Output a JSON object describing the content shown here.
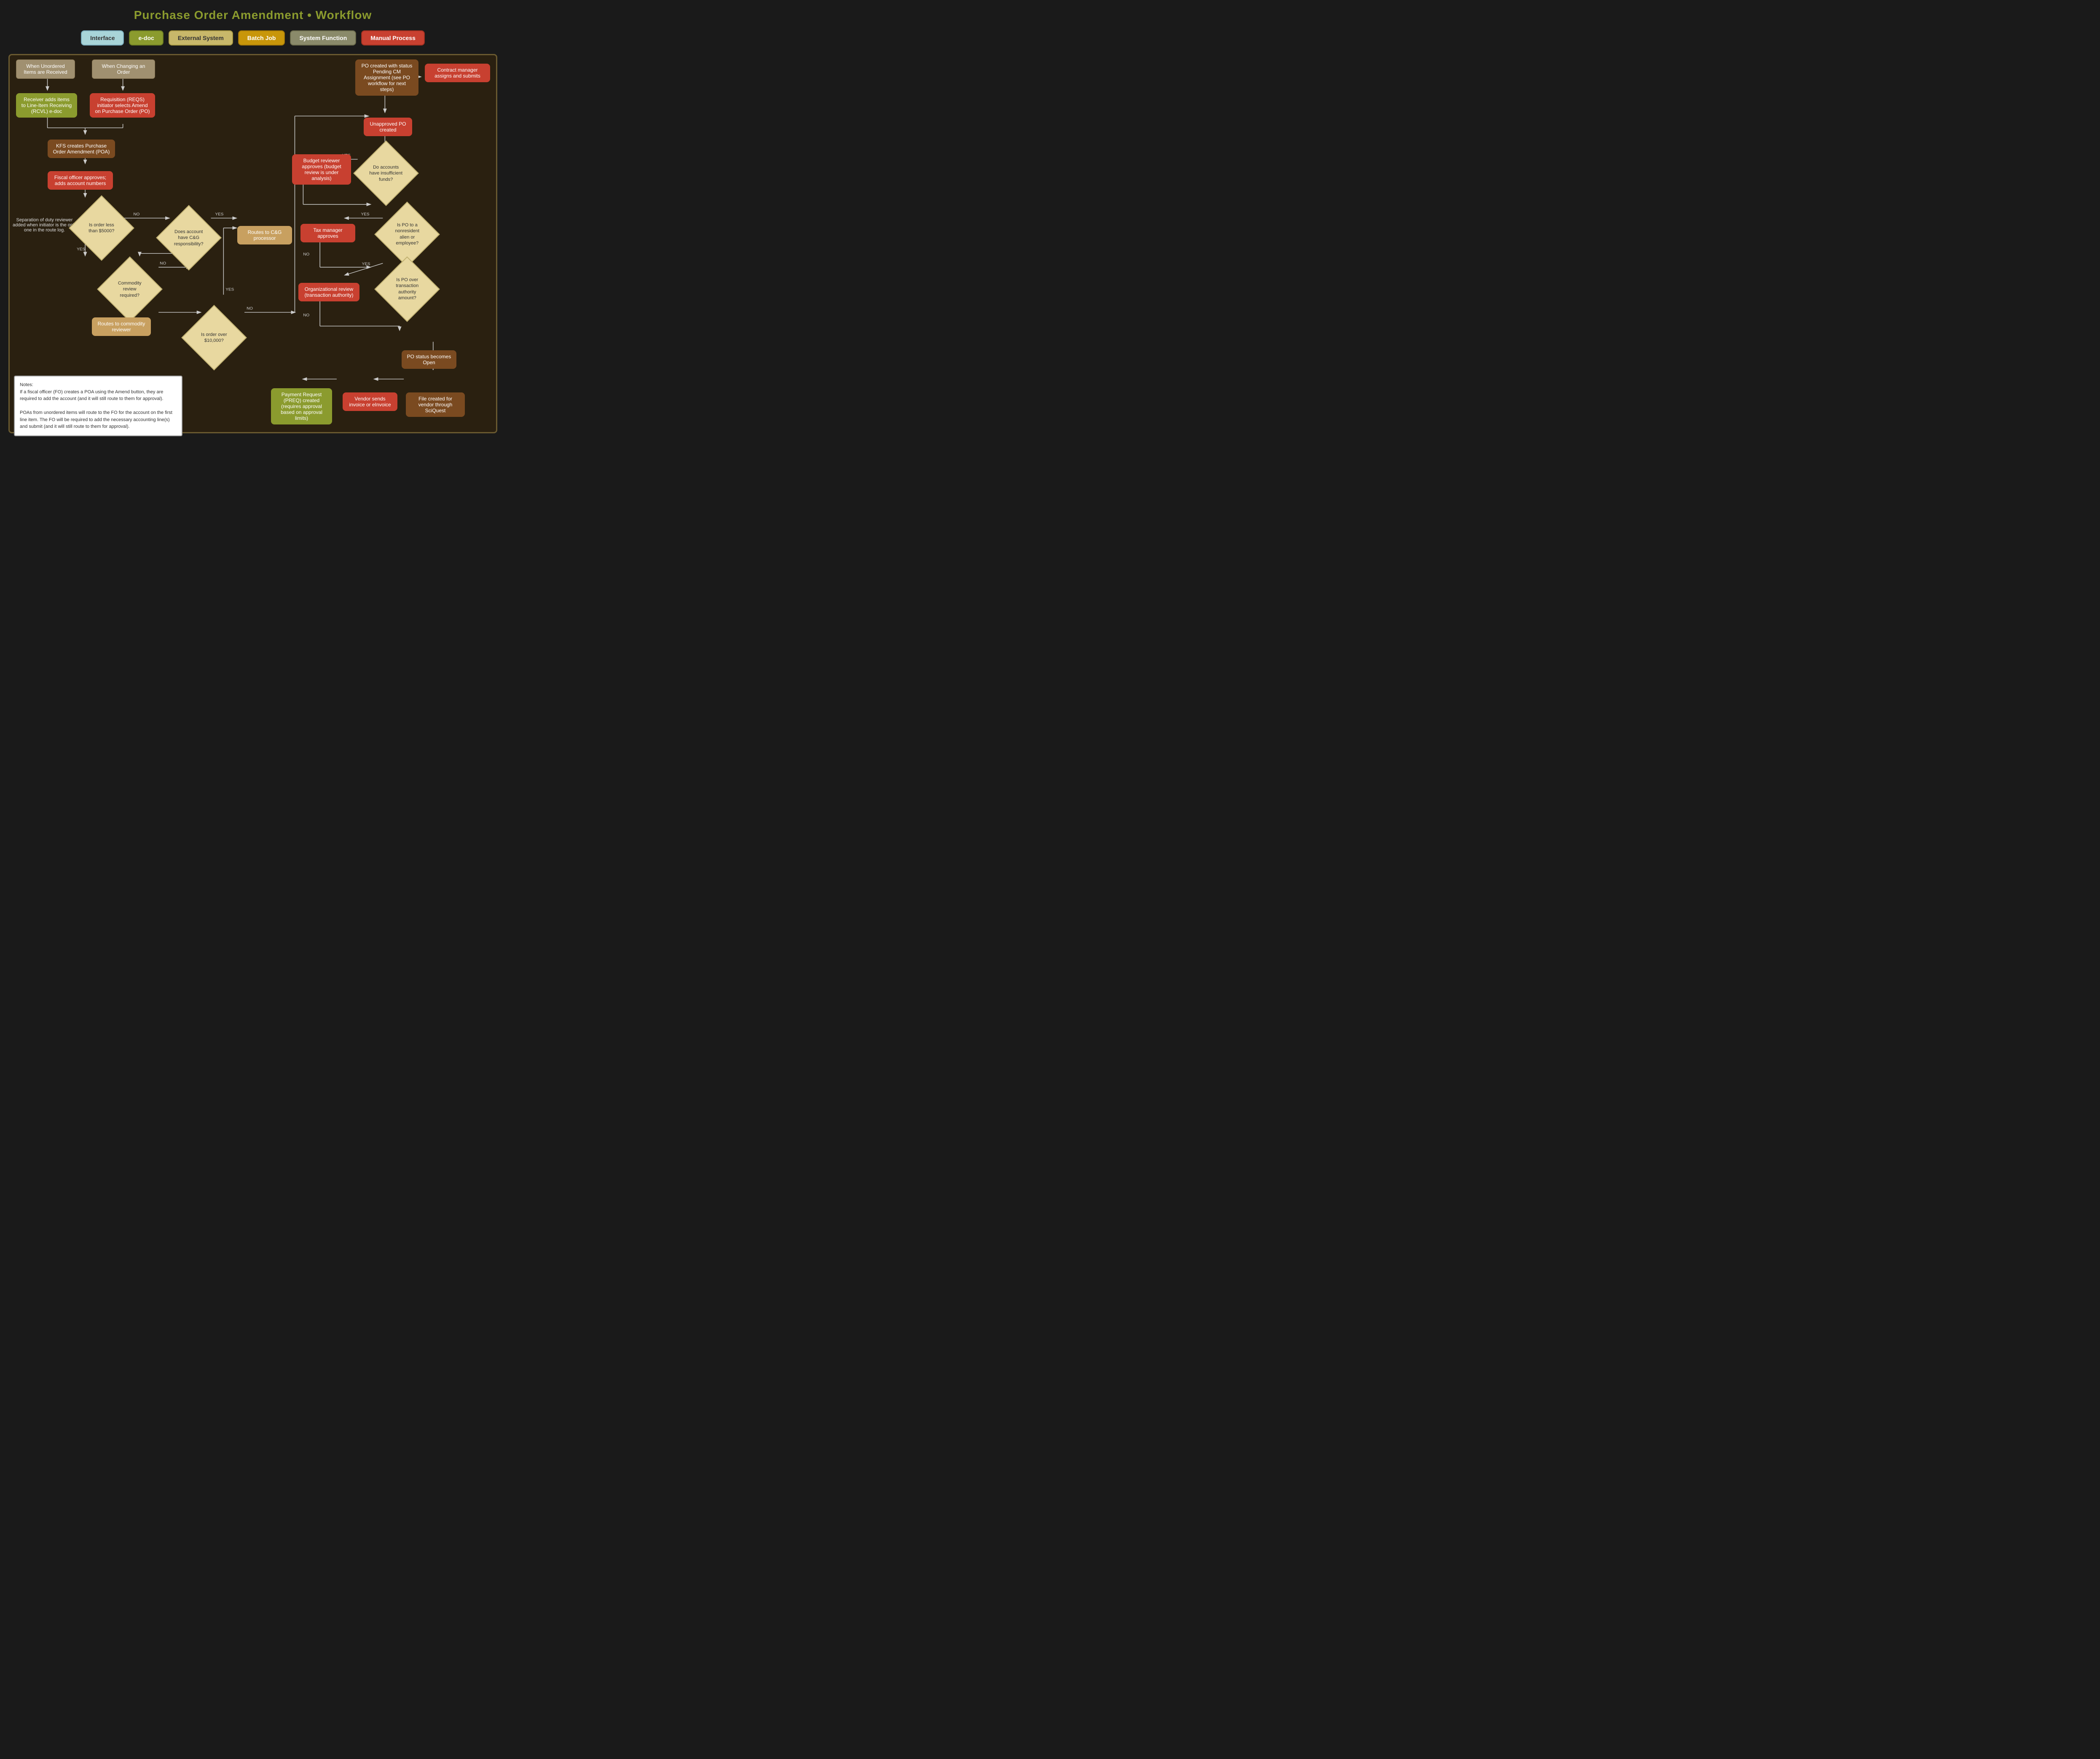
{
  "page": {
    "title": "Purchase Order Amendment • Workflow"
  },
  "legend": [
    {
      "id": "interface",
      "label": "Interface",
      "style": "legend-interface"
    },
    {
      "id": "edoc",
      "label": "e-doc",
      "style": "legend-edoc"
    },
    {
      "id": "external",
      "label": "External System",
      "style": "legend-external"
    },
    {
      "id": "batch",
      "label": "Batch Job",
      "style": "legend-batch"
    },
    {
      "id": "system",
      "label": "System Function",
      "style": "legend-system"
    },
    {
      "id": "manual",
      "label": "Manual Process",
      "style": "legend-manual"
    }
  ],
  "nodes": {
    "title1": "When Unordered Items are Received",
    "title2": "When Changing an Order",
    "receiver": "Receiver adds items to Line-Item Receiving (RCVL) e-doc",
    "requisition": "Requisition (REQS) initiator selects Amend on Purchase Order (PO)",
    "kfs": "KFS creates Purchase Order Amendment (POA)",
    "fiscal": "Fiscal officer approves; adds account numbers",
    "separation": "Separation of duty reviewer added when initiator is the only one in the route log.",
    "isOrder5k": "Is order less than $5000?",
    "doesAccount": "Does account have C&G responsibility?",
    "routesCG": "Routes to C&G processor",
    "commodityReview": "Commodity review required?",
    "routesCommodity": "Routes to commodity reviewer",
    "isOrder10k": "Is order over $10,000?",
    "poPending": "PO created with status Pending CM Assignment (see PO workflow for next steps)",
    "contractManager": "Contract manager assigns and submits",
    "unapprovedPO": "Unapproved PO created",
    "doAccounts": "Do accounts have insufficient funds?",
    "budgetReviewer": "Budget reviewer approves (budget review is under analysis)",
    "taxManager": "Tax manager approves",
    "isPONonresident": "Is PO to a nonresident alien or employee?",
    "orgReview": "Organizational review (transaction authority)",
    "isPOOver": "Is PO over transaction authority amount?",
    "poStatusOpen": "PO status becomes Open",
    "fileCreated": "File created for vendor through SciQuest",
    "vendorSends": "Vendor sends invoice or eInvoice",
    "paymentRequest": "Payment Request (PREQ) created (requires approval based on approval limits)",
    "notes": "Notes:\nIf a fiscal officer (FO) creates a POA using the Amend button, they are required to add the account (and it will still route to them for approval).\n\nPOAs from unordered items will route to the FO for the account on the first line item. The FO will be required to add the necessary accounting line(s) and submit (and it will still route to them for approval).",
    "yes": "YES",
    "no": "NO"
  }
}
